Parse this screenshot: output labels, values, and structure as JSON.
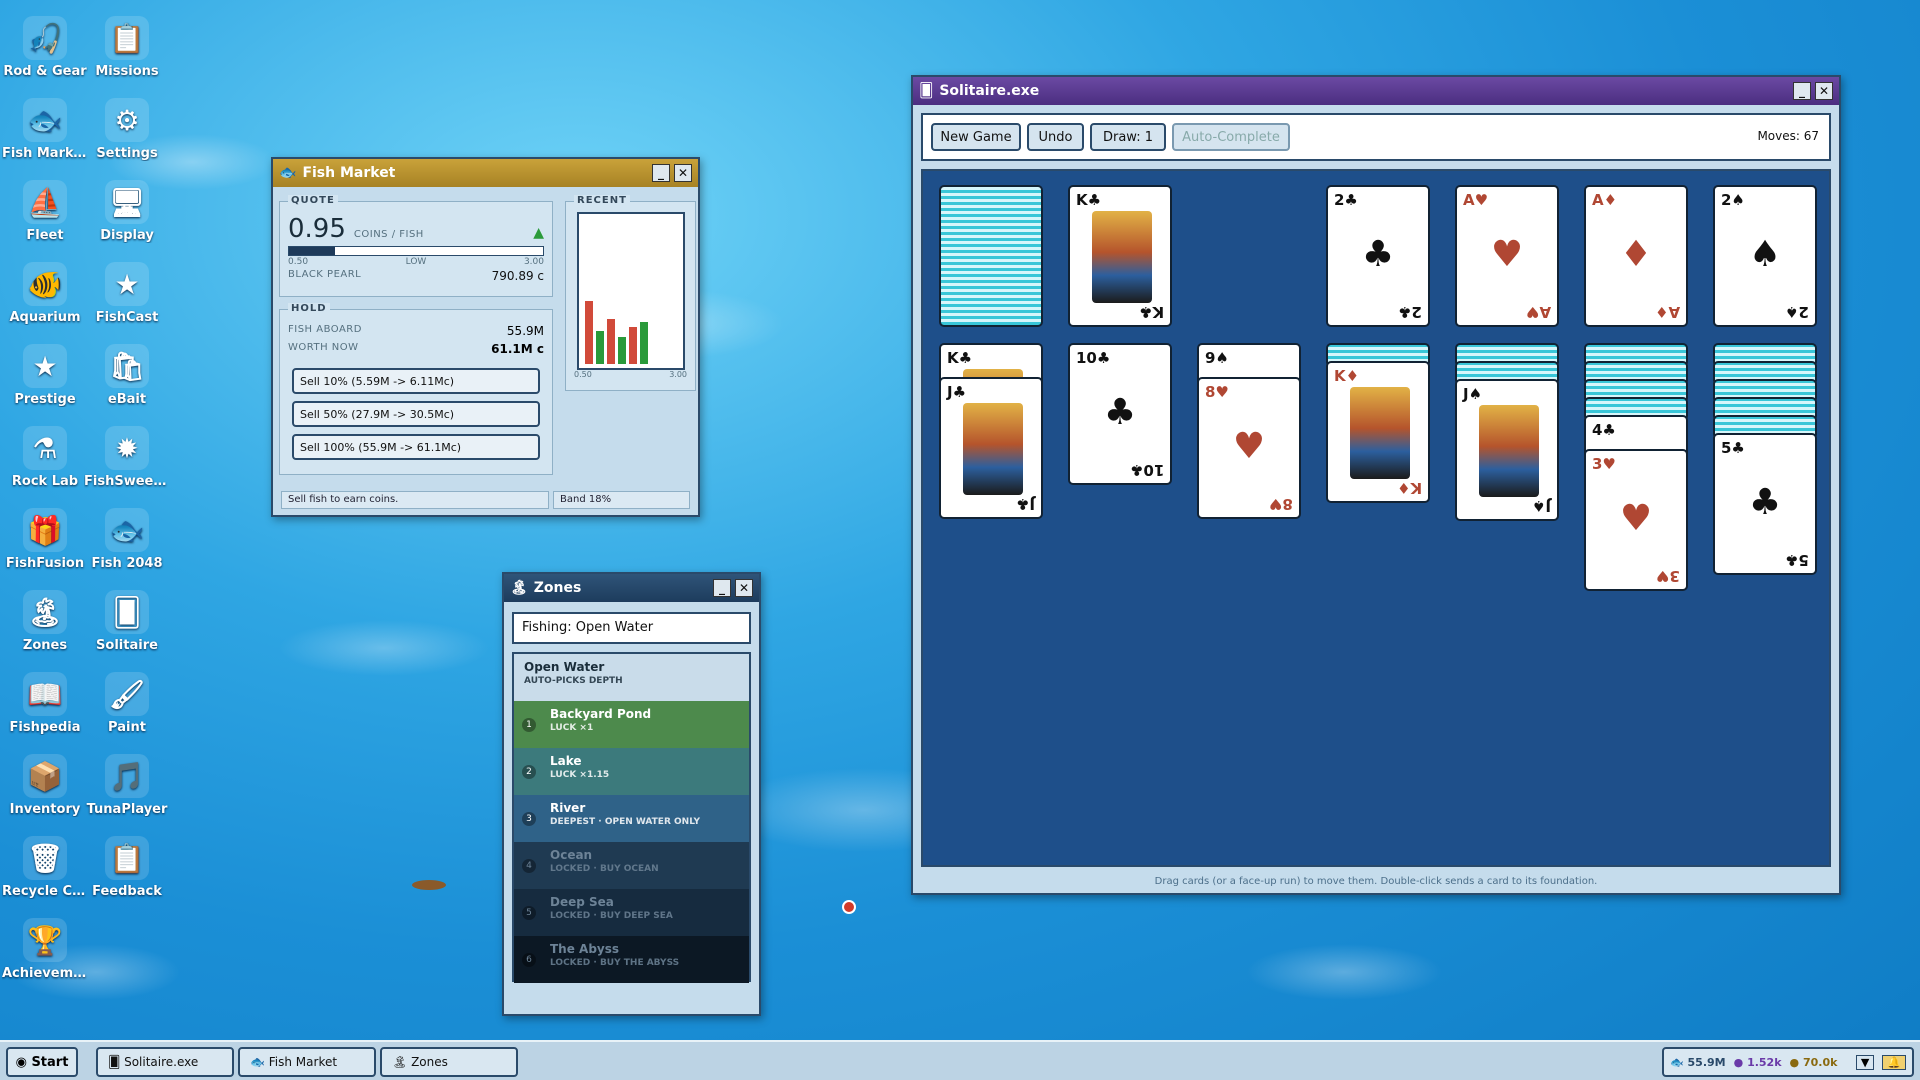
{
  "desktop": {
    "icons": [
      {
        "label": "Rod & Gear",
        "glyph": "🎣"
      },
      {
        "label": "Missions",
        "glyph": "📋"
      },
      {
        "label": "Fish Market",
        "glyph": "🐟"
      },
      {
        "label": "Settings",
        "glyph": "⚙"
      },
      {
        "label": "Fleet",
        "glyph": "⛵"
      },
      {
        "label": "Display",
        "glyph": "🖥"
      },
      {
        "label": "Aquarium",
        "glyph": "🐠"
      },
      {
        "label": "FishCast",
        "glyph": "★"
      },
      {
        "label": "Prestige",
        "glyph": "★"
      },
      {
        "label": "eBait",
        "glyph": "🛍"
      },
      {
        "label": "Rock Lab",
        "glyph": "⚗"
      },
      {
        "label": "FishSweeper",
        "glyph": "✹"
      },
      {
        "label": "FishFusion",
        "glyph": "🎁"
      },
      {
        "label": "Fish 2048",
        "glyph": "🐟"
      },
      {
        "label": "Zones",
        "glyph": "🏝"
      },
      {
        "label": "Solitaire",
        "glyph": "🂠"
      },
      {
        "label": "Fishpedia",
        "glyph": "📖"
      },
      {
        "label": "Paint",
        "glyph": "🖌"
      },
      {
        "label": "Inventory",
        "glyph": "📦"
      },
      {
        "label": "TunaPlayer",
        "glyph": "🎵"
      },
      {
        "label": "Recycle Ce...",
        "glyph": "🗑"
      },
      {
        "label": "Feedback",
        "glyph": "📋"
      },
      {
        "label": "Achieveme...",
        "glyph": "🏆"
      }
    ]
  },
  "fish_market": {
    "title": "Fish Market",
    "quote_label": "QUOTE",
    "quote_value": "0.95",
    "quote_unit": "COINS / FISH",
    "range_min": "0.50",
    "range_low": "LOW",
    "range_max": "3.00",
    "quote_fill": 0.18,
    "species_label": "BLACK PEARL",
    "species_value": "790.89 c",
    "recent_label": "RECENT",
    "recent_min": "0.50",
    "recent_max": "3.00",
    "recent_bars": [
      {
        "h": 0.42,
        "color": "#d14a3a"
      },
      {
        "h": 0.22,
        "color": "#2a9a3a"
      },
      {
        "h": 0.3,
        "color": "#d14a3a"
      },
      {
        "h": 0.18,
        "color": "#2a9a3a"
      },
      {
        "h": 0.25,
        "color": "#d14a3a"
      },
      {
        "h": 0.28,
        "color": "#2a9a3a"
      }
    ],
    "hold_label": "HOLD",
    "fish_aboard_label": "FISH ABOARD",
    "fish_aboard_value": "55.9M",
    "worth_now_label": "WORTH NOW",
    "worth_now_value": "61.1M c",
    "sell_10": "Sell 10% (5.59M -> 6.11Mc)",
    "sell_50": "Sell 50% (27.9M -> 30.5Mc)",
    "sell_100": "Sell 100% (55.9M -> 61.1Mc)",
    "status_left": "Sell fish to earn coins.",
    "status_right": "Band 18%"
  },
  "zones": {
    "title": "Zones",
    "current": "Fishing: Open Water",
    "items": [
      {
        "name": "Open Water",
        "sub": "AUTO-PICKS DEPTH",
        "bg": "#c9dcea",
        "fg": "#1a2d3a",
        "num": ""
      },
      {
        "name": "Backyard Pond",
        "sub": "LUCK ×1",
        "bg": "#4d8a4c",
        "fg": "#ffffff",
        "num": "1"
      },
      {
        "name": "Lake",
        "sub": "LUCK ×1.15",
        "bg": "#3c7a7c",
        "fg": "#ffffff",
        "num": "2"
      },
      {
        "name": "River",
        "sub": "DEEPEST · OPEN WATER ONLY",
        "bg": "#2f6288",
        "fg": "#ffffff",
        "num": "3"
      },
      {
        "name": "Ocean",
        "sub": "LOCKED · BUY OCEAN",
        "bg": "#1f3a52",
        "fg": "#6d8397",
        "num": "4"
      },
      {
        "name": "Deep Sea",
        "sub": "LOCKED · BUY DEEP SEA",
        "bg": "#162b3f",
        "fg": "#6d8397",
        "num": "5"
      },
      {
        "name": "The Abyss",
        "sub": "LOCKED · BUY THE ABYSS",
        "bg": "#0c1824",
        "fg": "#6d8397",
        "num": "6"
      }
    ]
  },
  "solitaire": {
    "title": "Solitaire.exe",
    "new_game": "New Game",
    "undo": "Undo",
    "draw": "Draw: 1",
    "auto_complete": "Auto-Complete",
    "moves": "Moves: 67",
    "footer": "Drag cards (or a face-up run) to move them. Double-click sends a card to its foundation.",
    "top_row": [
      {
        "type": "back"
      },
      {
        "type": "face",
        "rank": "K",
        "suit": "♣",
        "color": "blk"
      },
      {
        "type": "empty"
      },
      {
        "type": "pip",
        "rank": "2",
        "suit": "♣",
        "color": "blk"
      },
      {
        "type": "pip",
        "rank": "A",
        "suit": "♥",
        "color": "red"
      },
      {
        "type": "pip",
        "rank": "A",
        "suit": "♦",
        "color": "red"
      },
      {
        "type": "pip",
        "rank": "2",
        "suit": "♠",
        "color": "blk"
      }
    ],
    "tableau": [
      {
        "hidden": 0,
        "cards": [
          {
            "rank": "K",
            "suit": "♣",
            "color": "blk",
            "face": true
          },
          {
            "rank": "J",
            "suit": "♣",
            "color": "blk",
            "face": true
          }
        ]
      },
      {
        "hidden": 0,
        "cards": [
          {
            "rank": "10",
            "suit": "♣",
            "color": "blk"
          }
        ]
      },
      {
        "hidden": 0,
        "cards": [
          {
            "rank": "9",
            "suit": "♠",
            "color": "blk"
          },
          {
            "rank": "8",
            "suit": "♥",
            "color": "red"
          }
        ]
      },
      {
        "hidden": 1,
        "cards": [
          {
            "rank": "K",
            "suit": "♦",
            "color": "red",
            "face": true
          }
        ]
      },
      {
        "hidden": 2,
        "cards": [
          {
            "rank": "J",
            "suit": "♠",
            "color": "blk",
            "face": true
          }
        ]
      },
      {
        "hidden": 4,
        "cards": [
          {
            "rank": "4",
            "suit": "♣",
            "color": "blk"
          },
          {
            "rank": "3",
            "suit": "♥",
            "color": "red"
          }
        ]
      },
      {
        "hidden": 5,
        "cards": [
          {
            "rank": "5",
            "suit": "♣",
            "color": "blk"
          }
        ]
      }
    ]
  },
  "taskbar": {
    "start": "Start",
    "tasks": [
      "Solitaire.exe",
      "Fish Market",
      "Zones"
    ],
    "fish": "55.9M",
    "pearls": "1.52k",
    "coins": "70.0k"
  }
}
